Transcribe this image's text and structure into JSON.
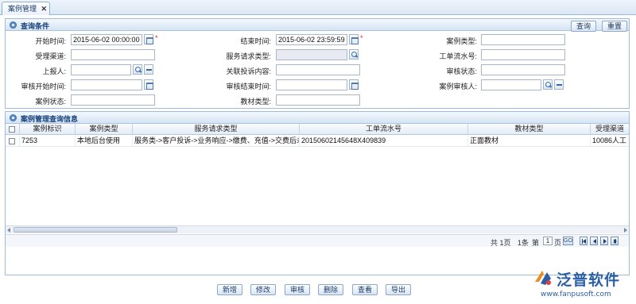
{
  "tab": {
    "label": "案例管理"
  },
  "query_panel": {
    "title": "查询条件",
    "search_button": "查询",
    "reset_button": "重置",
    "fields": {
      "start_time": {
        "label": "开始时间:",
        "value": "2015-06-02 00:00:00"
      },
      "end_time": {
        "label": "结束时间:",
        "value": "2015-06-02 23:59:59"
      },
      "case_type": {
        "label": "案例类型:",
        "value": ""
      },
      "channel": {
        "label": "受理渠道:",
        "value": ""
      },
      "service_type": {
        "label": "服务请求类型:",
        "value": ""
      },
      "ticket_no": {
        "label": "工单流水号:",
        "value": ""
      },
      "reporter": {
        "label": "上报人:",
        "value": ""
      },
      "complaint": {
        "label": "关联投诉内容:",
        "value": ""
      },
      "review_status": {
        "label": "审核状态:",
        "value": ""
      },
      "review_start": {
        "label": "审核开始时间:",
        "value": ""
      },
      "review_end": {
        "label": "审核结束时间:",
        "value": ""
      },
      "reviewer": {
        "label": "案例审核人:",
        "value": ""
      },
      "case_status": {
        "label": "案例状态:",
        "value": ""
      },
      "material_type": {
        "label": "教材类型:",
        "value": ""
      }
    }
  },
  "results_panel": {
    "title": "案例管理查询信息",
    "columns": [
      "案例标识",
      "案例类型",
      "服务请求类型",
      "工单流水号",
      "教材类型",
      "受理渠道"
    ],
    "rows": [
      {
        "id": "7253",
        "case_type": "本地后台使用",
        "service_type": "服务类->客户投诉->业务响应->缴费、充值->交费后未及",
        "ticket_no": "20150602145648X409839",
        "material_type": "正面教材",
        "channel": "10086人工"
      }
    ],
    "pager": {
      "total_pages": "共 1页",
      "total_records": "1条",
      "page_prefix": "第",
      "current_page": "1",
      "page_suffix": "页",
      "go": "GO"
    }
  },
  "actions": [
    "新增",
    "修改",
    "审核",
    "删除",
    "查看",
    "导出"
  ],
  "logo": {
    "text": "泛普软件",
    "url": "www.fanpusoft.com"
  }
}
